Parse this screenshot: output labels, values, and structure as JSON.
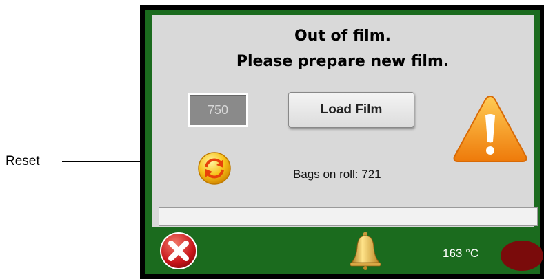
{
  "annotation": {
    "reset_label": "Reset"
  },
  "screen": {
    "message_line1": "Out of film.",
    "message_line2": "Please prepare new film.",
    "film_value": "750",
    "load_film_label": "Load Film",
    "bags_on_roll_label": "Bags on roll:",
    "bags_on_roll_value": "721",
    "icons": [
      "warning-icon",
      "reset-icon"
    ]
  },
  "bottom_bar": {
    "temperature": "163 °C",
    "icons": [
      "close-icon",
      "bell-icon",
      "status-indicator"
    ]
  },
  "colors": {
    "panel_green": "#1b6b1e",
    "screen_gray": "#d9d9d9",
    "warning_orange": "#f08a0c",
    "indicator_red": "#7a0b0b"
  }
}
